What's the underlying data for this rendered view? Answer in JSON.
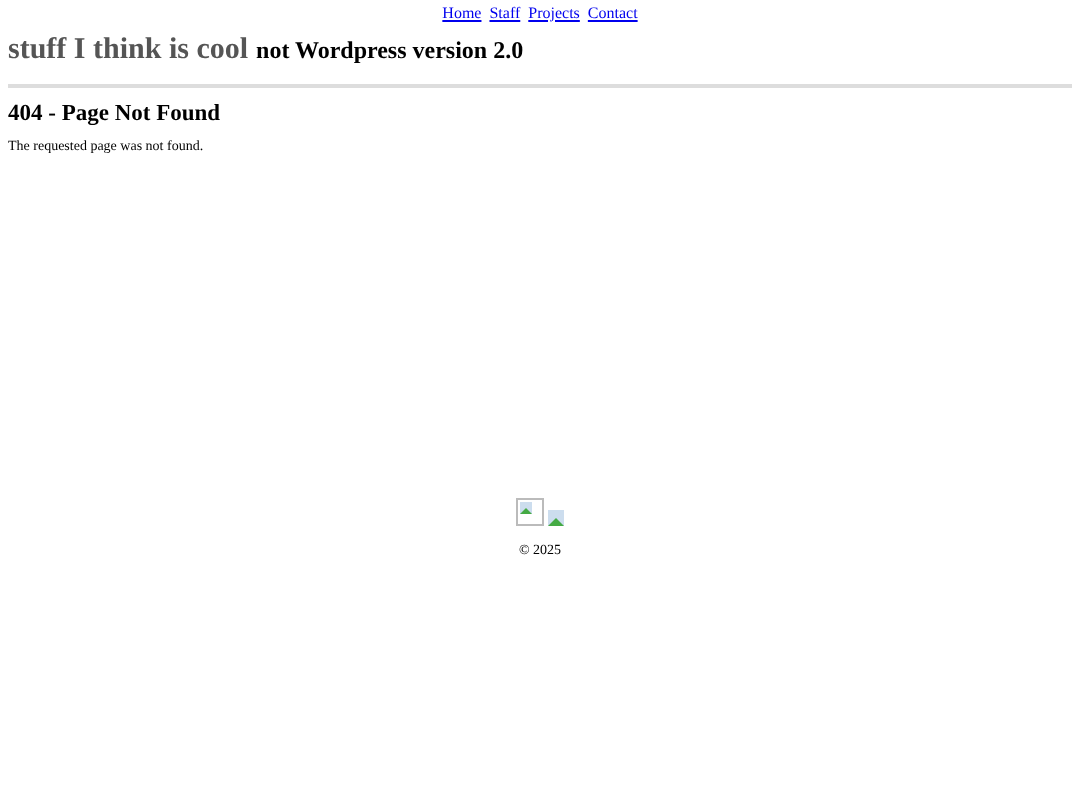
{
  "nav": [
    "Home",
    "Staff",
    "Projects",
    "Contact"
  ],
  "site_title": "stuff I think is cool",
  "tagline": "not Wordpress version 2.0",
  "heading": "404 - Page Not Found",
  "message": "The requested page was not found.",
  "footer": {
    "copyright": "© 2025"
  }
}
